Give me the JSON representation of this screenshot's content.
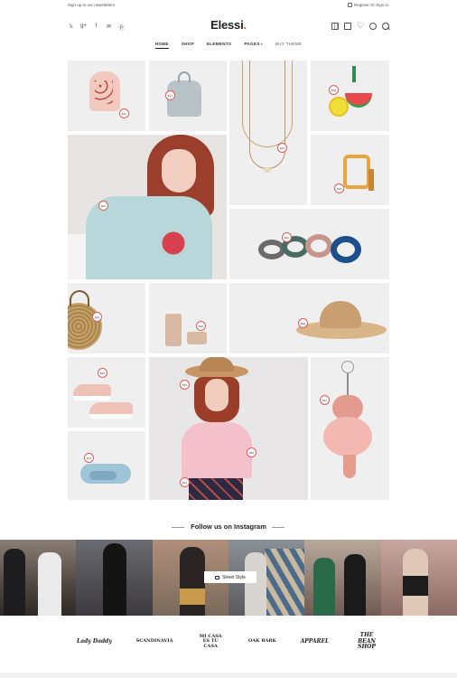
{
  "topbar": {
    "newsletter": "Sign up to our newsletters",
    "account": "Register Or Sign in"
  },
  "header": {
    "logo_text": "Elessi",
    "logo_dot": ".",
    "social_icons": [
      "twitter-icon",
      "google-plus-icon",
      "facebook-icon",
      "email-icon",
      "pinterest-icon"
    ],
    "tool_icons": [
      "compare-icon",
      "account-icon",
      "wishlist-icon",
      "sync-icon",
      "search-icon"
    ]
  },
  "nav": {
    "items": [
      "HOME",
      "SHOP",
      "ELEMENTS",
      "PAGES",
      "BUY THEME"
    ]
  },
  "grid": {
    "prices": {
      "backpack_pink": "$34",
      "backpack_grey": "$17",
      "necklace": "$26",
      "earrings": "$18",
      "model_tee": "$32",
      "sandals": "$28",
      "hair_ties": "$40",
      "straw_bag": "$43",
      "heels": "$16",
      "hat": "$28",
      "sneakers": "$26",
      "model_hat_top": "$45",
      "model_hat_bottom": "$56",
      "model_hat_side": "$16",
      "keychain": "$24",
      "scarf": "$79"
    }
  },
  "instagram": {
    "title": "Follow us on Instagram",
    "button_label": "Street Style",
    "photo_colors": [
      "#5a5048",
      "#3c3a3e",
      "#7a6a5c",
      "#8a7d72",
      "#6e5a52",
      "#9a8878"
    ]
  },
  "brands": [
    "Lady Daddy",
    "SCANDINAVIA",
    "MI CASA ES TU CASA",
    "OAK BARK",
    "APPAREL",
    "THE BEAN SHOP"
  ],
  "colors": {
    "accent": "#e94f4f",
    "tile_bg": "#efefef"
  }
}
